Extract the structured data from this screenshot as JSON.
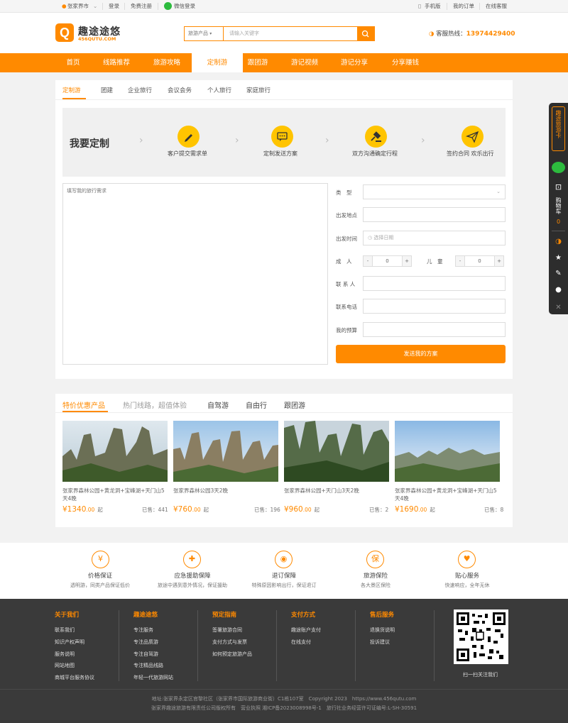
{
  "topbar": {
    "location": "张家界市",
    "login": "登录",
    "register": "免费注册",
    "wechat_login": "微信登录",
    "mobile": "手机版",
    "my_orders": "我的订单",
    "online_service": "在线客服"
  },
  "header": {
    "logo_letter": "Q",
    "logo_title": "趣途途悠",
    "logo_domain": "456QUTU.COM",
    "search_category": "旅游产品",
    "search_placeholder": "请输入关键字",
    "hotline_label": "客服热线：",
    "hotline_number": "13974429400"
  },
  "nav": [
    "首页",
    "线路推荐",
    "旅游攻略",
    "定制游",
    "跟团游",
    "游记视频",
    "游记分享",
    "分享赚钱"
  ],
  "nav_active": "定制游",
  "custom": {
    "tabs": [
      "定制游",
      "团建",
      "企业旅行",
      "会议会务",
      "个人旅行",
      "家庭旅行"
    ],
    "heading": "我要定制",
    "steps": [
      "客户提交需求单",
      "定制发送方案",
      "双方沟通确定行程",
      "签约合同 欢乐出行"
    ],
    "textarea_placeholder": "填写我的旅行需求",
    "form": {
      "type_label": "类　型",
      "depart_place_label": "出发地点",
      "depart_time_label": "出发时间",
      "date_placeholder": "选择日期",
      "adult_label": "成　人",
      "child_label": "儿　童",
      "adult_count": "0",
      "child_count": "0",
      "minus": "-",
      "plus": "+",
      "contact_label": "联 系 人",
      "phone_label": "联系电话",
      "budget_label": "我的预算",
      "submit": "发送我的方案"
    }
  },
  "products": {
    "tabs": [
      "特价优惠产品",
      "热门线路，超值体验",
      "自驾游",
      "自由行",
      "跟团游"
    ],
    "items": [
      {
        "title": "张家界森林公园+黄龙洞+宝峰湖+天门山5天4晚",
        "price": "¥1340",
        "decimal": ".00",
        "unit": "起",
        "sold": "已售：441"
      },
      {
        "title": "张家界森林公园3天2晚",
        "price": "¥760",
        "decimal": ".00",
        "unit": "起",
        "sold": "已售：196"
      },
      {
        "title": "张家界森林公园+天门山3天2晚",
        "price": "¥960",
        "decimal": ".00",
        "unit": "起",
        "sold": "已售：2"
      },
      {
        "title": "张家界森林公园+黄龙洞+宝峰湖+天门山5天4晚",
        "price": "¥1690",
        "decimal": ".00",
        "unit": "起",
        "sold": "已售：8"
      }
    ]
  },
  "features": [
    {
      "icon": "yen-icon",
      "glyph": "¥",
      "title": "价格保证",
      "desc": "透明游，同类产品保证低价"
    },
    {
      "icon": "shield-icon",
      "glyph": "✚",
      "title": "应急援助保障",
      "desc": "旅途中遇到意外情况，保证援助"
    },
    {
      "icon": "camera-icon",
      "glyph": "◉",
      "title": "退订保障",
      "desc": "特殊原因影响出行，保证退订"
    },
    {
      "icon": "guarantee-icon",
      "glyph": "保",
      "title": "旅游保险",
      "desc": "各大景区保险"
    },
    {
      "icon": "heart-icon",
      "glyph": "♥",
      "title": "贴心服务",
      "desc": "快速响应，全年无休"
    }
  ],
  "footer": {
    "columns": [
      {
        "title": "关于我们",
        "links": [
          "联系我们",
          "知识产权声明",
          "服务说明",
          "网站地图",
          "商城平台服务协议"
        ]
      },
      {
        "title": "趣途途悠",
        "links": [
          "专注服务",
          "专注品质游",
          "专注自驾游",
          "专注精品线路",
          "年轻一代旅游网站"
        ]
      },
      {
        "title": "预定指南",
        "links": [
          "签署旅游合同",
          "支付方式与发票",
          "如何预定旅游产品"
        ]
      },
      {
        "title": "支付方式",
        "links": [
          "趣途账户支付",
          "在线支付"
        ]
      },
      {
        "title": "售后服务",
        "links": [
          "退换货说明",
          "投诉建议"
        ]
      }
    ],
    "qr_caption": "扫一扫关注我们",
    "copyright_line1": "地址:张家界永定区官黎社区（张家界市国际旅游商业街）C1栋107室　Copyright 2023　https://www.456qutu.com",
    "copyright_line2": "张家界趣途旅游有限责任公司版权所有　营业执照 湘ICP备2023008998号-1　旅行社业务经营许可证编号:L-SH-30591"
  },
  "sidebar": {
    "card": "趣途旅游卡",
    "cart": "购物车",
    "cart_count": "0"
  },
  "colors": {
    "accent": "#ff8a00",
    "step_yellow": "#ffc400",
    "footer_bg": "#3a3a3a"
  }
}
